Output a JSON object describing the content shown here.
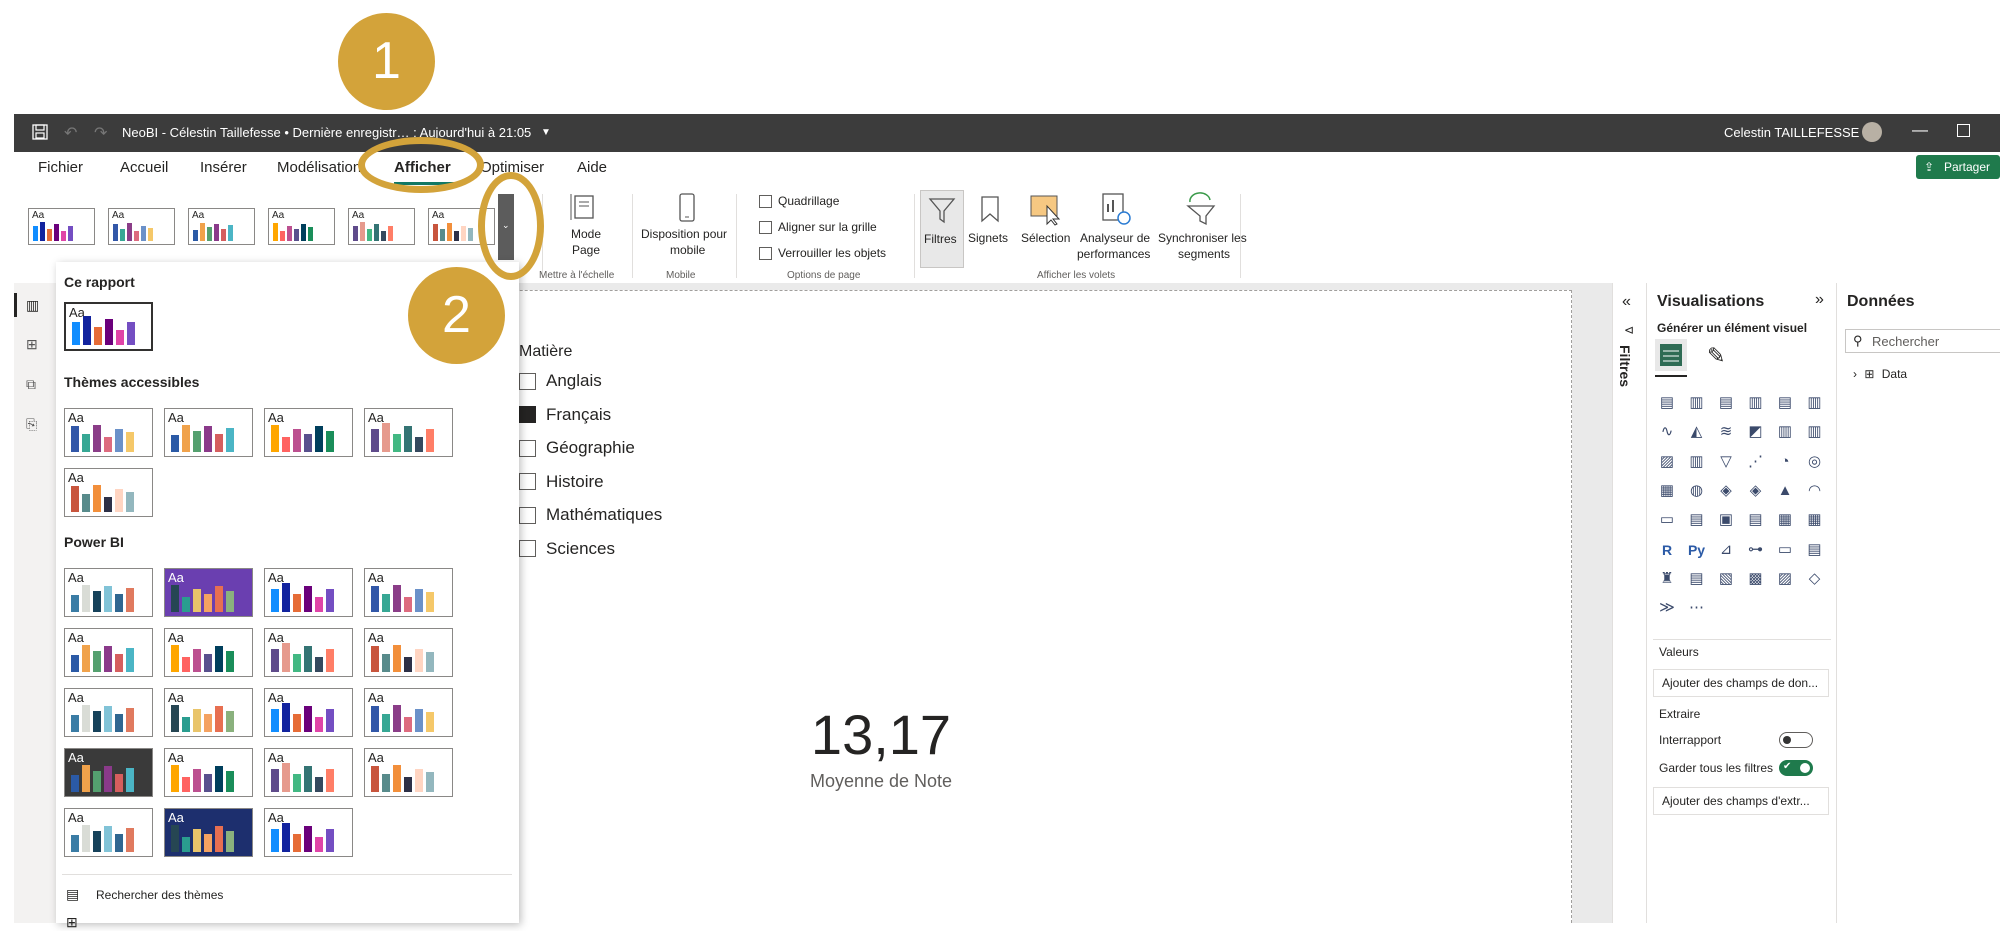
{
  "annotations": {
    "badge1": "1",
    "badge2": "2"
  },
  "colors": {
    "badge": "#d3a33a",
    "titlebar": "#3c3c3c",
    "accent": "#1f7a4c",
    "tab_underline": "#117865"
  },
  "titlebar": {
    "title": "NeoBI - Célestin Taillefesse • Dernière enregistr… : Aujourd'hui à 21:05",
    "user": "Celestin TAILLEFESSE",
    "icons": [
      "save-icon",
      "undo-icon",
      "redo-icon",
      "minimize-icon",
      "maximize-icon",
      "close-icon"
    ]
  },
  "menu": {
    "items": [
      "Fichier",
      "Accueil",
      "Insérer",
      "Modélisation",
      "Afficher",
      "Optimiser",
      "Aide"
    ],
    "share": "Partager"
  },
  "ribbon": {
    "mode_page": "Mode\nPage",
    "mode_page_line1": "Mode",
    "mode_page_line2": "Page",
    "group_scale": "Mettre à l'échelle",
    "mobile_line1": "Disposition pour",
    "mobile_line2": "mobile",
    "group_mobile": "Mobile",
    "checks": [
      "Quadrillage",
      "Aligner sur la grille",
      "Verrouiller les objets"
    ],
    "group_page": "Options de page",
    "filtres": "Filtres",
    "signets": "Signets",
    "selection": "Sélection",
    "analyseur_line1": "Analyseur de",
    "analyseur_line2": "performances",
    "sync_line1": "Synchroniser les",
    "sync_line2": "segments",
    "group_volets": "Afficher les volets",
    "theme_aa": "Aa"
  },
  "dropdown": {
    "section_report": "Ce rapport",
    "section_accessible": "Thèmes accessibles",
    "section_powerbi": "Power BI",
    "search_themes": "Rechercher des thèmes"
  },
  "slicer": {
    "title": "Matière",
    "items": [
      {
        "label": "Anglais",
        "checked": false
      },
      {
        "label": "Français",
        "checked": true
      },
      {
        "label": "Géographie",
        "checked": false
      },
      {
        "label": "Histoire",
        "checked": false
      },
      {
        "label": "Mathématiques",
        "checked": false
      },
      {
        "label": "Sciences",
        "checked": false
      }
    ]
  },
  "card": {
    "value": "13,17",
    "label": "Moyenne de Note"
  },
  "filters_pane": {
    "label": "Filtres"
  },
  "viz_pane": {
    "title": "Visualisations",
    "subtitle": "Générer un élément visuel",
    "values_label": "Valeurs",
    "values_placeholder": "Ajouter des champs de don...",
    "extract_label": "Extraire",
    "cross_report": "Interrapport",
    "cross_report_on": false,
    "keep_filters": "Garder tous les filtres",
    "keep_filters_on": true,
    "extract_placeholder": "Ajouter des champs d'extr..."
  },
  "data_pane": {
    "title": "Données",
    "search_placeholder": "Rechercher",
    "tables": [
      "Data"
    ]
  }
}
